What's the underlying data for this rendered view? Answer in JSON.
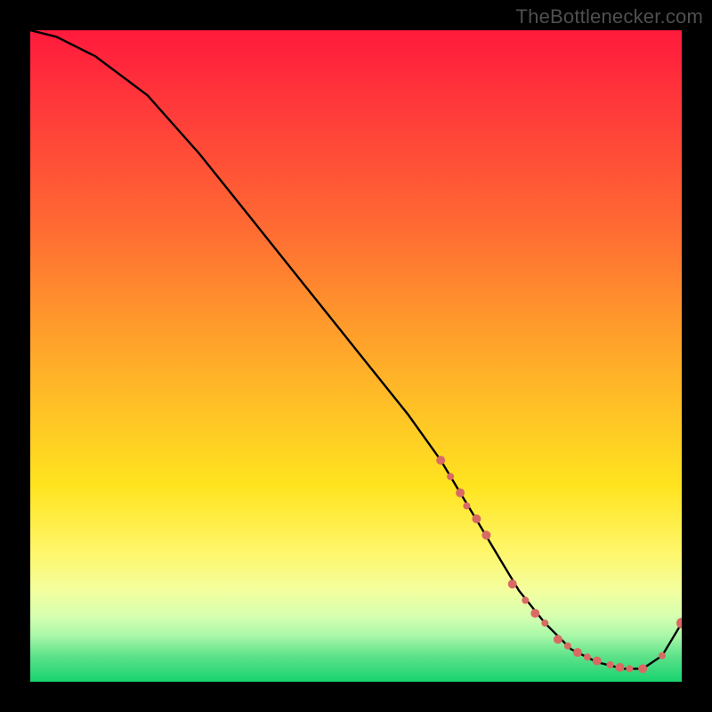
{
  "watermark": "TheBottlenecker.com",
  "chart_data": {
    "type": "line",
    "title": "",
    "xlabel": "",
    "ylabel": "",
    "xlim": [
      0,
      100
    ],
    "ylim": [
      0,
      100
    ],
    "x": [
      0,
      4,
      10,
      18,
      26,
      34,
      42,
      50,
      58,
      63,
      66,
      69,
      72,
      75,
      79,
      83,
      87,
      91,
      94,
      97,
      100
    ],
    "values": [
      100,
      99,
      96,
      90,
      81,
      71,
      61,
      51,
      41,
      34,
      29,
      24,
      19,
      14,
      9,
      5,
      3,
      2,
      2,
      4,
      9
    ],
    "dots": {
      "x": [
        63,
        64.5,
        66,
        67,
        68.5,
        70,
        74,
        76,
        77.5,
        79,
        81,
        82.5,
        84,
        85.5,
        87,
        89,
        90.5,
        92,
        94,
        97,
        100
      ],
      "y": [
        34,
        31.5,
        29,
        27,
        25,
        22.5,
        15,
        12.5,
        10.5,
        9,
        6.5,
        5.5,
        4.5,
        3.8,
        3.2,
        2.6,
        2.2,
        2,
        2,
        4,
        9
      ],
      "radius": [
        5,
        4,
        5,
        4,
        5,
        5,
        5,
        4,
        5,
        4,
        5,
        4,
        5,
        4,
        5,
        4,
        5,
        4,
        5,
        4,
        6
      ]
    },
    "colors": {
      "line": "#000000",
      "dots": "#d86a63",
      "gradient_top": "#ff1a3c",
      "gradient_bottom": "#17d36f"
    }
  }
}
